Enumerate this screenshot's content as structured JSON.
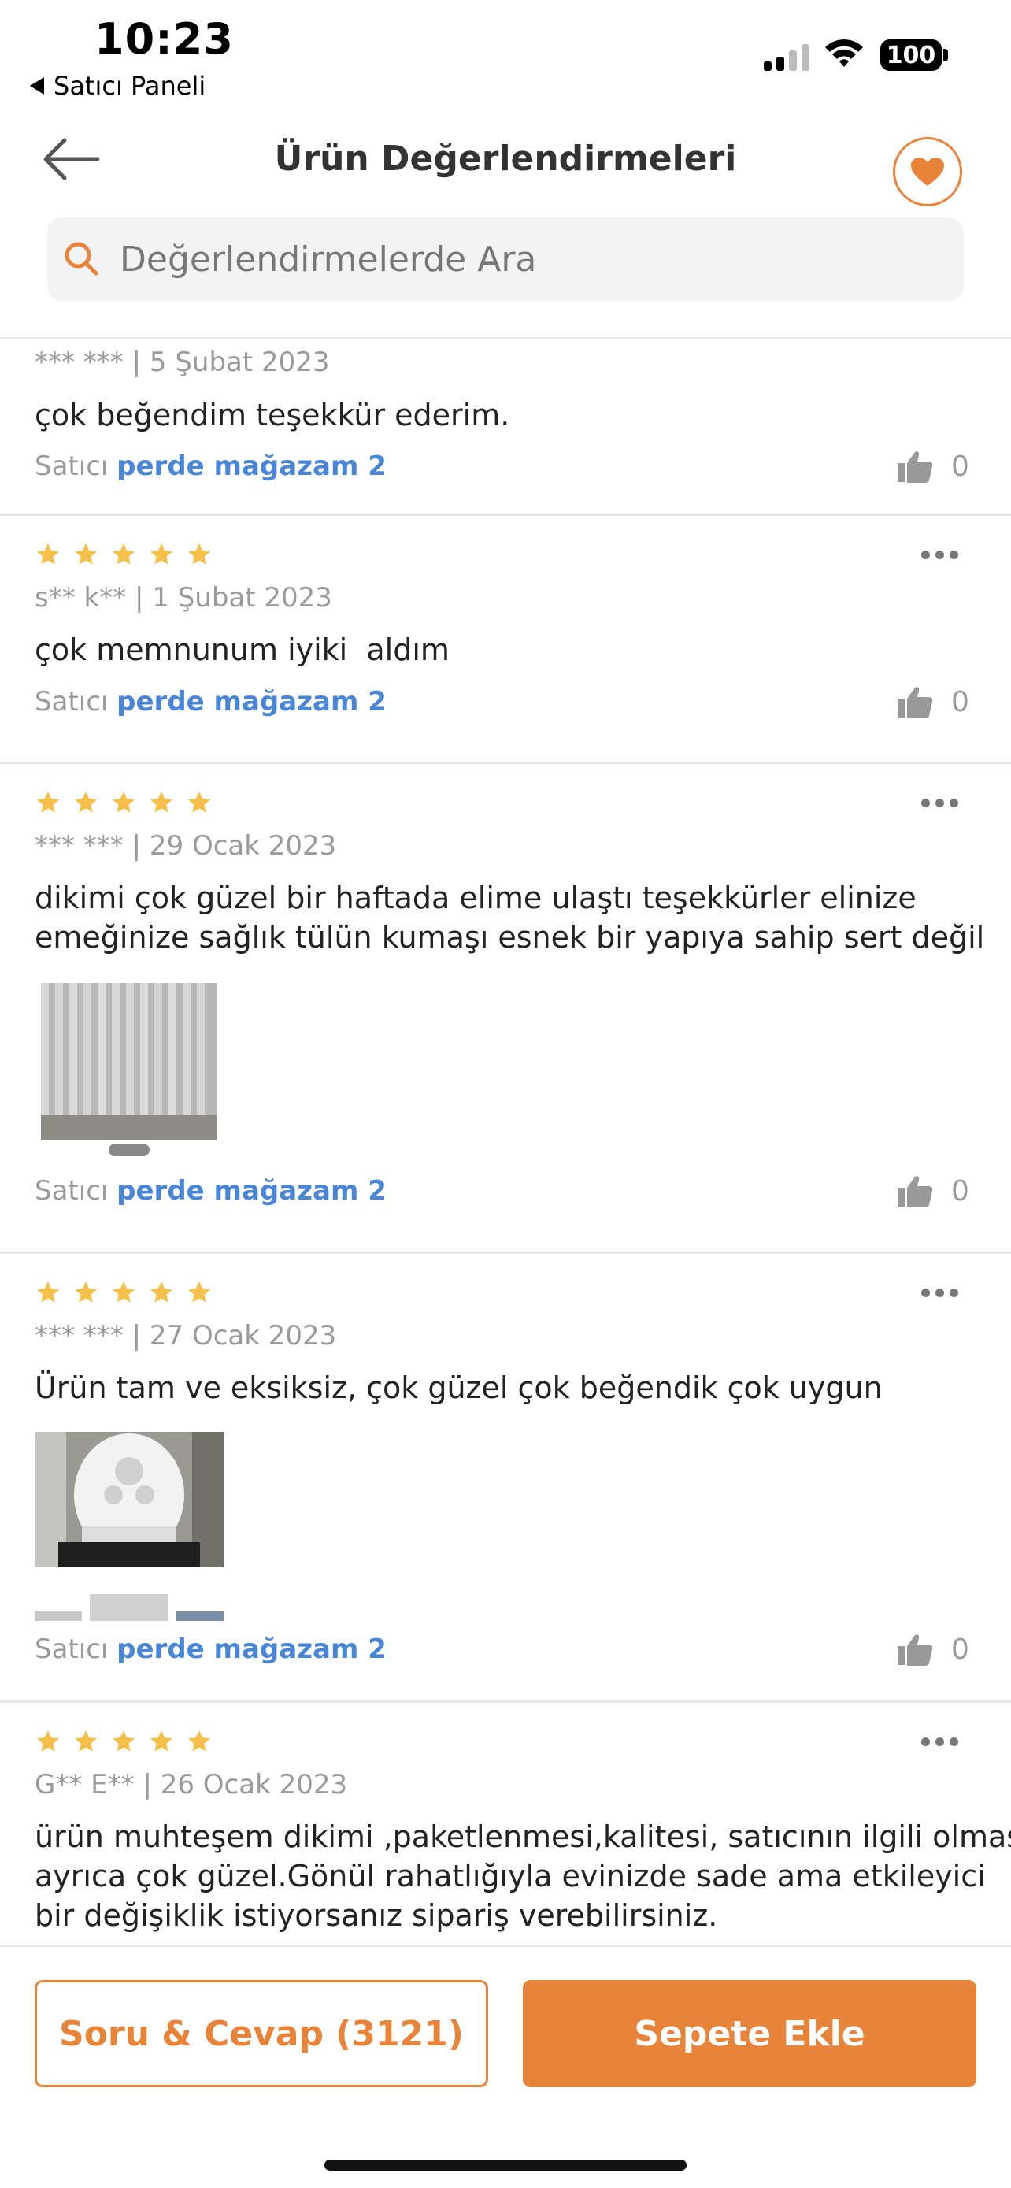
{
  "status_bar": {
    "time": "10:23",
    "back_app_label": "Satıcı Paneli",
    "battery": "100"
  },
  "nav": {
    "title": "Ürün Değerlendirmeleri",
    "back_icon": "arrow-left-icon",
    "favorite_icon": "heart-icon"
  },
  "search": {
    "placeholder": "Değerlendirmelerde Ara"
  },
  "colors": {
    "accent": "#e8833a",
    "star": "#f5c04a",
    "seller_link": "#4a86d8"
  },
  "reviews": [
    {
      "meta": "*** *** | 5 Şubat 2023",
      "comment": "çok beğendim teşekkür ederim.",
      "seller_prefix": "Satıcı",
      "seller_name": "perde mağazam 2",
      "likes": "0"
    },
    {
      "rating": 5,
      "meta": "s** k** | 1 Şubat 2023",
      "comment": "çok memnunum iyiki  aldım",
      "seller_prefix": "Satıcı",
      "seller_name": "perde mağazam 2",
      "likes": "0"
    },
    {
      "rating": 5,
      "meta": "*** *** | 29 Ocak 2023",
      "comment": "dikimi çok güzel bir haftada elime ulaştı teşekkürler elinize\nemeğinize sağlık tülün kumaşı esnek bir yapıya sahip sert değil",
      "seller_prefix": "Satıcı",
      "seller_name": "perde mağazam 2",
      "likes": "0"
    },
    {
      "rating": 5,
      "meta": "*** *** | 27 Ocak 2023",
      "comment": "Ürün tam ve eksiksiz, çok güzel çok beğendik çok uygun",
      "seller_prefix": "Satıcı",
      "seller_name": "perde mağazam 2",
      "likes": "0"
    },
    {
      "rating": 5,
      "meta": "G** E** | 26 Ocak 2023",
      "comment": "ürün muhteşem dikimi ,paketlenmesi,kalitesi, satıcının ilgili olması\nayrıca çok güzel.Gönül rahatlığıyla evinizde sade ama etkileyici\nbir değişiklik istiyorsanız sipariş verebilirsiniz."
    }
  ],
  "bottom_bar": {
    "qa_button": "Soru & Cevap (3121)",
    "add_to_cart_button": "Sepete Ekle"
  }
}
